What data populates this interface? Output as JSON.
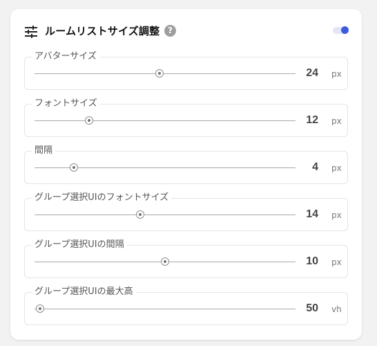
{
  "panel": {
    "title": "ルームリストサイズ調整",
    "icon": "sliders-icon",
    "help_icon": "help-icon",
    "help_glyph": "?",
    "toggle_on": true,
    "accent_color": "#3b5bdb"
  },
  "settings": [
    {
      "label": "アバターサイズ",
      "value": "24",
      "unit": "px",
      "fraction": 0.48
    },
    {
      "label": "フォントサイズ",
      "value": "12",
      "unit": "px",
      "fraction": 0.21
    },
    {
      "label": "間隔",
      "value": "4",
      "unit": "px",
      "fraction": 0.15
    },
    {
      "label": "グループ選択UIのフォントサイズ",
      "value": "14",
      "unit": "px",
      "fraction": 0.405
    },
    {
      "label": "グループ選択UIの間隔",
      "value": "10",
      "unit": "px",
      "fraction": 0.5
    },
    {
      "label": "グループ選択UIの最大高",
      "value": "50",
      "unit": "vh",
      "fraction": 0.02
    }
  ]
}
